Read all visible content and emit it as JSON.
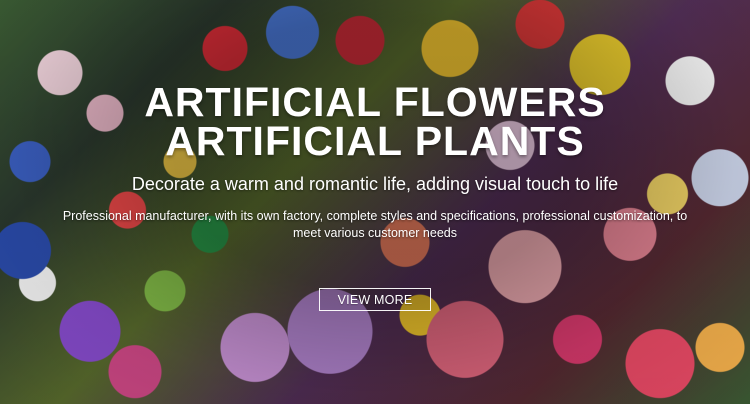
{
  "hero": {
    "title_line_1": "ARTIFICIAL FLOWERS",
    "title_line_2": "ARTIFICIAL PLANTS",
    "subtitle": "Decorate a warm and romantic life, adding visual touch to life",
    "description": "Professional manufacturer, with its own factory, complete styles and specifications, professional customization, to meet various customer needs",
    "button_label": "VIEW MORE"
  },
  "colors": {
    "text": "#ffffff",
    "button_border": "#ffffff"
  }
}
